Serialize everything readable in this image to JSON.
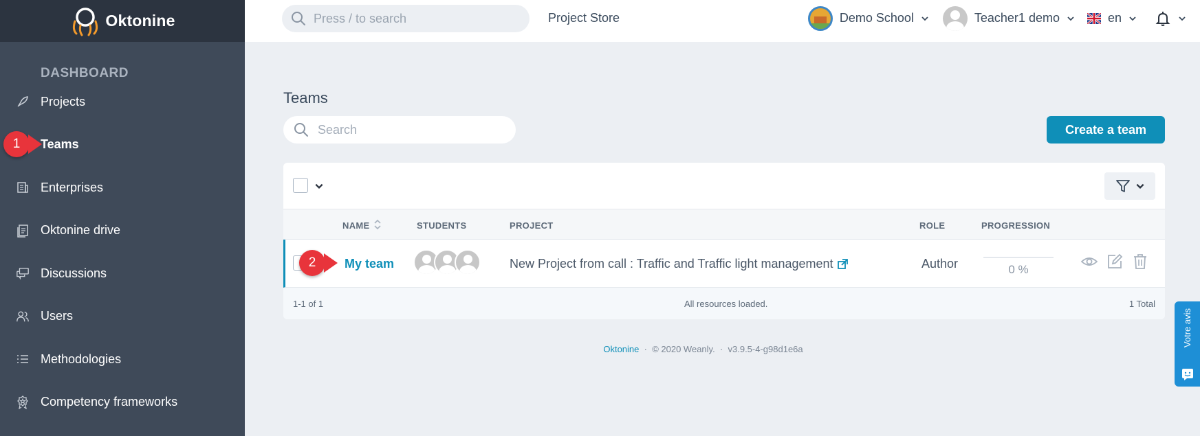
{
  "app": {
    "logo_text": "Oktonine"
  },
  "sidebar": {
    "section_title": "DASHBOARD",
    "items": [
      {
        "label": "Projects",
        "icon": "rocket-icon"
      },
      {
        "label": "Teams",
        "icon": "team-icon",
        "active": true
      },
      {
        "label": "Enterprises",
        "icon": "enterprise-icon"
      },
      {
        "label": "Oktonine drive",
        "icon": "drive-icon"
      },
      {
        "label": "Discussions",
        "icon": "discussion-icon"
      },
      {
        "label": "Users",
        "icon": "users-icon"
      },
      {
        "label": "Methodologies",
        "icon": "list-icon"
      },
      {
        "label": "Competency frameworks",
        "icon": "badge-icon"
      }
    ]
  },
  "topbar": {
    "search_placeholder": "Press / to search",
    "project_store": "Project Store",
    "school": "Demo School",
    "user": "Teacher1 demo",
    "language": "en"
  },
  "main": {
    "title": "Teams",
    "search_placeholder": "Search",
    "create_button": "Create a team"
  },
  "table": {
    "columns": {
      "name": "NAME",
      "students": "STUDENTS",
      "project": "PROJECT",
      "role": "ROLE",
      "progression": "PROGRESSION"
    },
    "rows": [
      {
        "name": "My team",
        "students_count": 3,
        "project": "New Project from call : Traffic and Traffic light management",
        "role": "Author",
        "progression": "0 %"
      }
    ],
    "footer": {
      "range": "1-1 of 1",
      "status": "All resources loaded.",
      "total": "1 Total"
    }
  },
  "footer": {
    "brand": "Oktonine",
    "copyright": "© 2020 Weanly.",
    "version": "v3.9.5-4-g98d1e6a",
    "separator": "·"
  },
  "feedback": {
    "label": "Votre avis"
  },
  "annotations": [
    "1",
    "2"
  ],
  "colors": {
    "accent": "#0f8fb8",
    "sidebar": "#3f4a59",
    "sidebar_top": "#2c3440",
    "badge": "#e8343b",
    "feedback": "#1e8fd6"
  }
}
